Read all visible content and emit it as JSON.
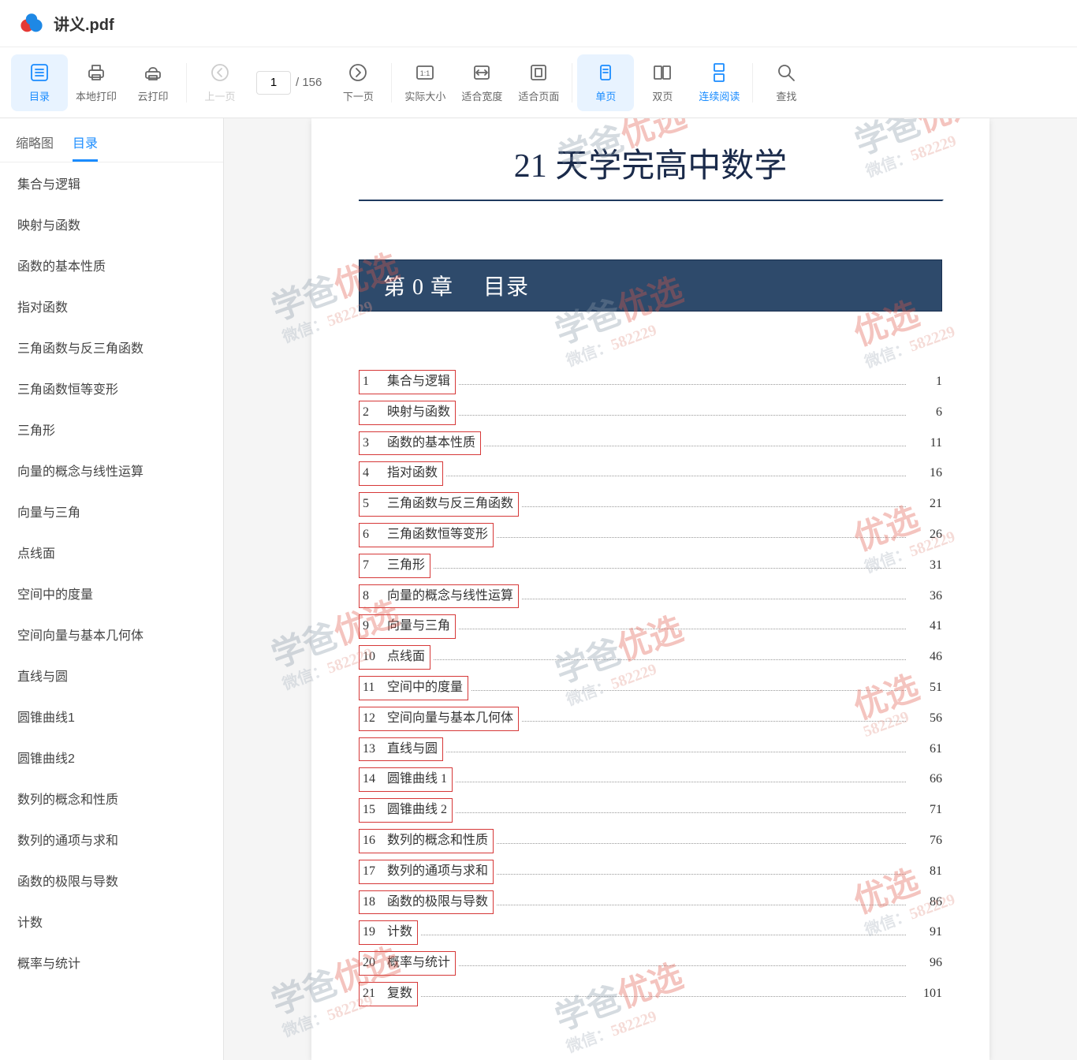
{
  "header": {
    "file_title": "讲义.pdf"
  },
  "toolbar": {
    "catalog": "目录",
    "local_print": "本地打印",
    "cloud_print": "云打印",
    "prev": "上一页",
    "next": "下一页",
    "actual": "实际大小",
    "fit_width": "适合宽度",
    "fit_page": "适合页面",
    "single": "单页",
    "double": "双页",
    "continuous": "连续阅读",
    "find": "查找",
    "page_current": "1",
    "page_total": "/ 156"
  },
  "sidebar": {
    "tab_thumb": "缩略图",
    "tab_toc": "目录",
    "items": [
      "集合与逻辑",
      "映射与函数",
      "函数的基本性质",
      "指对函数",
      "三角函数与反三角函数",
      "三角函数恒等变形",
      "三角形",
      "向量的概念与线性运算",
      "向量与三角",
      "点线面",
      "空间中的度量",
      "空间向量与基本几何体",
      "直线与圆",
      "圆锥曲线1",
      "圆锥曲线2",
      "数列的概念和性质",
      "数列的通项与求和",
      "函数的极限与导数",
      "计数",
      "概率与统计"
    ]
  },
  "doc": {
    "title": "21 天学完高中数学",
    "chapter_label": "第 0 章",
    "chapter_name": "目录",
    "toc": [
      {
        "n": "1",
        "t": "集合与逻辑",
        "p": "1"
      },
      {
        "n": "2",
        "t": "映射与函数",
        "p": "6"
      },
      {
        "n": "3",
        "t": "函数的基本性质",
        "p": "11"
      },
      {
        "n": "4",
        "t": "指对函数",
        "p": "16"
      },
      {
        "n": "5",
        "t": "三角函数与反三角函数",
        "p": "21"
      },
      {
        "n": "6",
        "t": "三角函数恒等变形",
        "p": "26"
      },
      {
        "n": "7",
        "t": "三角形",
        "p": "31"
      },
      {
        "n": "8",
        "t": "向量的概念与线性运算",
        "p": "36"
      },
      {
        "n": "9",
        "t": "向量与三角",
        "p": "41"
      },
      {
        "n": "10",
        "t": "点线面",
        "p": "46"
      },
      {
        "n": "11",
        "t": "空间中的度量",
        "p": "51"
      },
      {
        "n": "12",
        "t": "空间向量与基本几何体",
        "p": "56"
      },
      {
        "n": "13",
        "t": "直线与圆",
        "p": "61"
      },
      {
        "n": "14",
        "t": "圆锥曲线 1",
        "p": "66"
      },
      {
        "n": "15",
        "t": "圆锥曲线 2",
        "p": "71"
      },
      {
        "n": "16",
        "t": "数列的概念和性质",
        "p": "76"
      },
      {
        "n": "17",
        "t": "数列的通项与求和",
        "p": "81"
      },
      {
        "n": "18",
        "t": "函数的极限与导数",
        "p": "86"
      },
      {
        "n": "19",
        "t": "计数",
        "p": "91"
      },
      {
        "n": "20",
        "t": "概率与统计",
        "p": "96"
      },
      {
        "n": "21",
        "t": "复数",
        "p": "101"
      }
    ]
  },
  "watermark": {
    "brand_a": "学爸",
    "brand_b": "优选",
    "sub_a": "微信：",
    "sub_b": "582229"
  }
}
